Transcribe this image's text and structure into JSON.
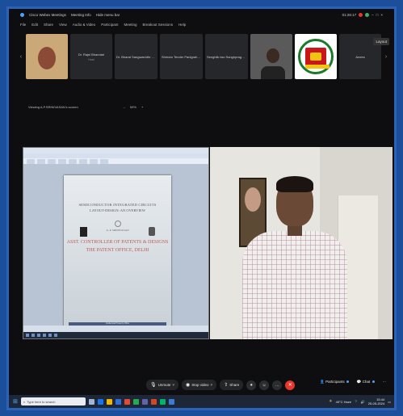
{
  "window": {
    "title": "Cisco Webex Meetings",
    "meeting_info": "Meeting Info",
    "hide_menu": "Hide menu bar",
    "time_right": "01:26:17"
  },
  "menu": [
    "File",
    "Edit",
    "Share",
    "View",
    "Audio & Video",
    "Participant",
    "Meeting",
    "Breakout Sessions",
    "Help"
  ],
  "participants": [
    {
      "type": "photo",
      "label": ""
    },
    {
      "type": "plain",
      "name": "Dr. Rajni Bhandari",
      "sub": "Host"
    },
    {
      "type": "plain",
      "name": "Dr. Bharat Sangwan/dhr (DTH...",
      "sub": ""
    },
    {
      "type": "plain",
      "name": "Shriram Tender Panigrahy(SE...",
      "sub": ""
    },
    {
      "type": "plain",
      "name": "Senghlik iwo Sanghpragon(eg...",
      "sub": ""
    },
    {
      "type": "video",
      "label": ""
    },
    {
      "type": "logo",
      "label": ""
    },
    {
      "type": "plain",
      "name": "Anees",
      "sub": ""
    }
  ],
  "layout_label": "Layout",
  "viewing": {
    "text": "Viewing A.P.SRINIVASAN's screen",
    "zoom": "59%"
  },
  "slide": {
    "title1": "SEMICONDUCTOR INTEGRATED CIRCUITS",
    "title2": "LAYOUT-DESIGN: AN OVERVIEW",
    "author": "A. P. SRINIVASAN",
    "role": "ASST. CONTROLLER OF PATENTS & DESIGNS",
    "office": "THE PATENT OFFICE, DELHI",
    "footer": "Intellectual Property Office"
  },
  "controls": {
    "unmute": "Unmute",
    "stop_video": "Stop video",
    "share": "Share",
    "participants": "Participants",
    "chat": "Chat"
  },
  "taskbar": {
    "search": "Type here to search",
    "weather": "40°C Haze",
    "time": "15:44",
    "date": "25-05-2024"
  }
}
